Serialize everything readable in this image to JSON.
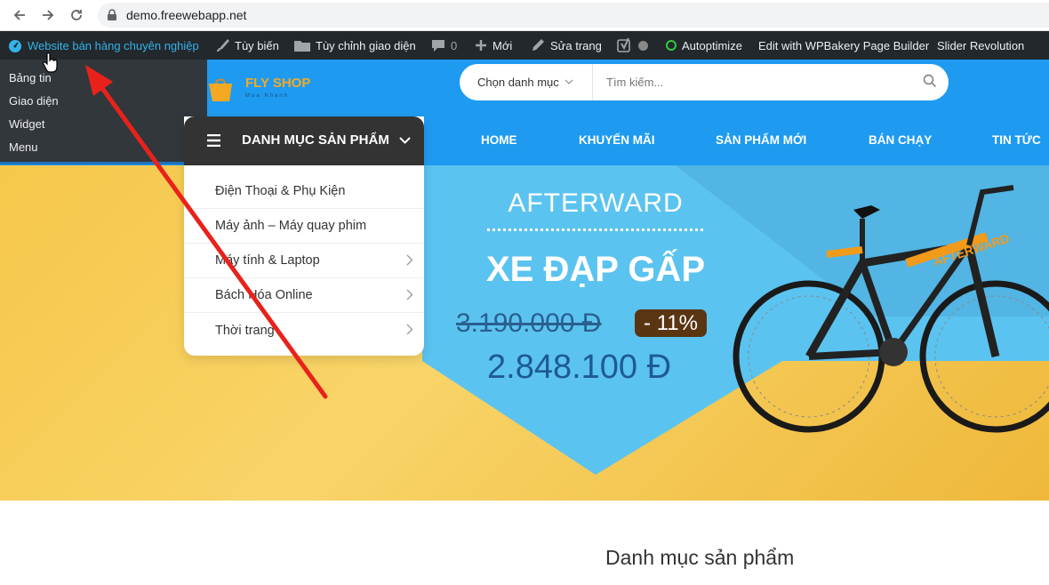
{
  "browser": {
    "url": "demo.freewebapp.net"
  },
  "admin_bar": {
    "site_name": "Website bán hàng chuyên nghiệp",
    "customize": "Tùy biến",
    "customize_theme": "Tùy chỉnh giao diện",
    "comments_count": "0",
    "new": "Mới",
    "edit_page": "Sửa trang",
    "autoptimize": "Autoptimize",
    "wpbakery": "Edit with WPBakery Page Builder",
    "slider": "Slider Revolution"
  },
  "site_dropdown": {
    "items": [
      "Bảng tin",
      "Giao diện",
      "Widget",
      "Menu"
    ]
  },
  "header": {
    "logo_text": "FLY SHOP",
    "logo_tagline": "Mua Nhanh",
    "category_select": "Chọn danh mục",
    "search_placeholder": "Tìm kiếm..."
  },
  "category_menu": {
    "title": "DANH MỤC SẢN PHẨM",
    "items": [
      "Điện Thoại & Phụ Kiện",
      "Máy ảnh – Máy quay phim",
      "Máy tính & Laptop",
      "Bách Hóa Online",
      "Thời trang"
    ]
  },
  "main_nav": {
    "items": [
      "HOME",
      "KHUYẾN MÃI",
      "SẢN PHẨM MỚI",
      "BÁN CHẠY",
      "TIN TỨC"
    ]
  },
  "banner": {
    "brand": "AFTERWARD",
    "product": "XE ĐẠP GẤP",
    "old_price": "3.190.000 Đ",
    "discount": "- 11%",
    "new_price": "2.848.100 Đ",
    "bike_decal": "AFTERWARD"
  },
  "section": {
    "title": "Danh mục sản phẩm"
  },
  "colors": {
    "admin_bar": "#23282d",
    "header_blue": "#1e9bf0",
    "banner_yellow": "#f6c74a",
    "arrow_red": "#e8221b"
  }
}
